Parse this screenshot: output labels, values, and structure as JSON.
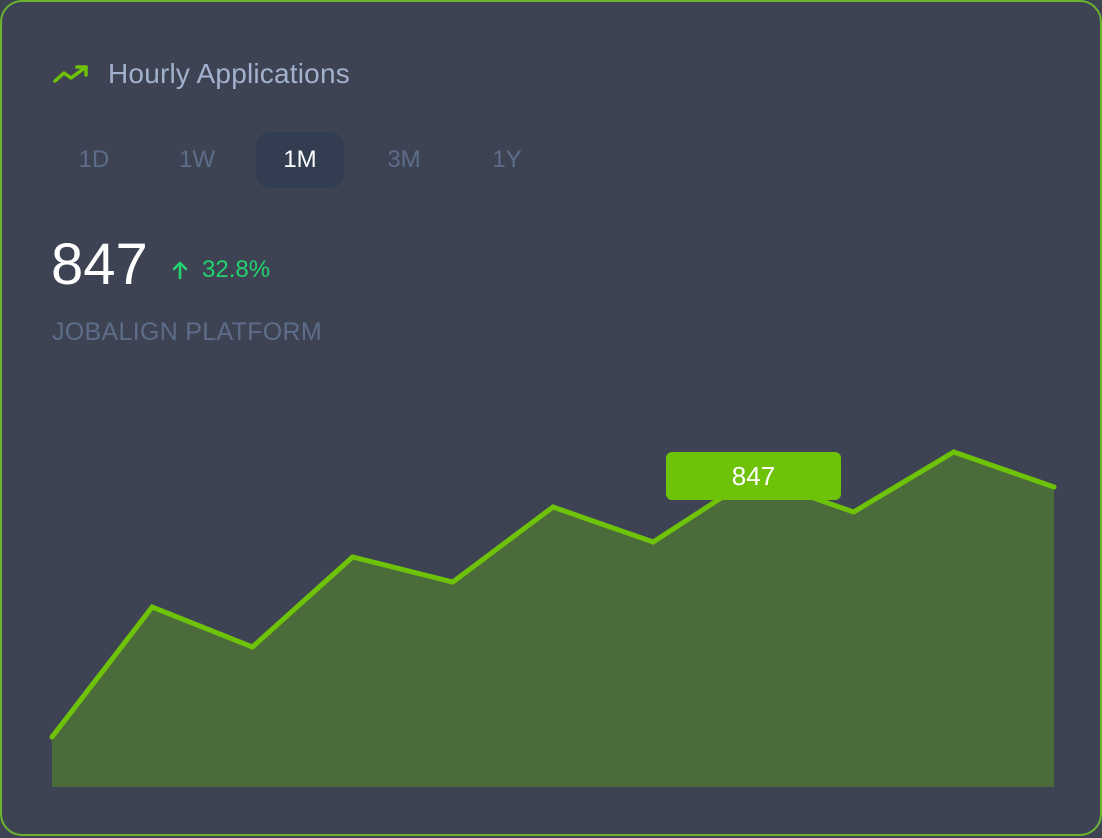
{
  "header": {
    "title": "Hourly Applications",
    "icon": "trending-up-icon",
    "accent": "#6ec308"
  },
  "tabs": [
    {
      "label": "1D",
      "active": false
    },
    {
      "label": "1W",
      "active": false
    },
    {
      "label": "1M",
      "active": true
    },
    {
      "label": "3M",
      "active": false
    },
    {
      "label": "1Y",
      "active": false
    }
  ],
  "summary": {
    "value": "847",
    "change": "32.8%",
    "change_icon": "arrow-up-icon",
    "change_color": "#22d36e",
    "subtitle": "JOBALIGN PLATFORM"
  },
  "tooltip": {
    "label": "847",
    "index": 7
  },
  "chart_data": {
    "type": "area",
    "x": [
      0,
      1,
      2,
      3,
      4,
      5,
      6,
      7,
      8,
      9,
      10
    ],
    "series": [
      {
        "values": [
          460,
          590,
          550,
          640,
          615,
          690,
          655,
          720,
          685,
          745,
          710
        ],
        "color": "#6ec308"
      }
    ],
    "ylim": [
      410,
      860
    ],
    "grid": false,
    "legend": "none",
    "title": "",
    "xlabel": "",
    "ylabel": ""
  }
}
